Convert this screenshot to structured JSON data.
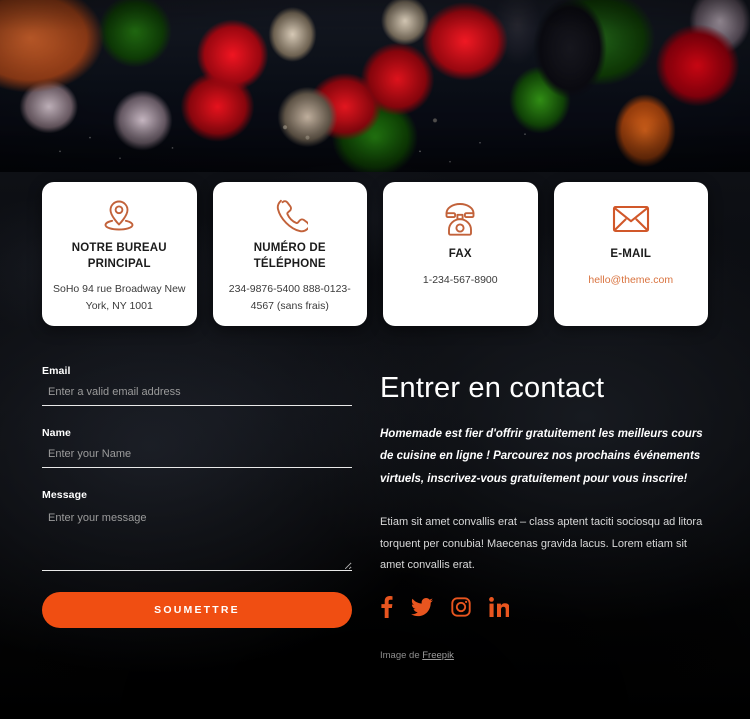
{
  "hero": {
    "alt": "fresh vegetables on dark slate background"
  },
  "cards": [
    {
      "icon": "location-pin-icon",
      "title": "NOTRE BUREAU PRINCIPAL",
      "body": "SoHo 94 rue Broadway New York, NY 1001",
      "link": null
    },
    {
      "icon": "phone-handset-icon",
      "title": "NUMÉRO DE TÉLÉPHONE",
      "body": "234-9876-5400\n888-0123-4567 (sans frais)",
      "link": null
    },
    {
      "icon": "fax-telephone-icon",
      "title": "FAX",
      "body": "1-234-567-8900",
      "link": null
    },
    {
      "icon": "envelope-icon",
      "title": "E-MAIL",
      "body": null,
      "link": "hello@theme.com"
    }
  ],
  "form": {
    "email": {
      "label": "Email",
      "placeholder": "Enter a valid email address",
      "value": ""
    },
    "name": {
      "label": "Name",
      "placeholder": "Enter your Name",
      "value": ""
    },
    "message": {
      "label": "Message",
      "placeholder": "Enter your message",
      "value": ""
    },
    "submit_label": "SOUMETTRE"
  },
  "info": {
    "title": "Entrer en contact",
    "lead": "Homemade est fier d'offrir gratuitement les meilleurs cours de cuisine en ligne ! Parcourez nos prochains événements virtuels, inscrivez-vous gratuitement pour vous inscrire!",
    "body": "Etiam sit amet convallis erat – class aptent taciti sociosqu ad litora torquent per conubia! Maecenas gravida lacus. Lorem etiam sit amet convallis erat.",
    "socials": [
      {
        "name": "facebook",
        "label": "Facebook"
      },
      {
        "name": "twitter",
        "label": "Twitter"
      },
      {
        "name": "instagram",
        "label": "Instagram"
      },
      {
        "name": "linkedin",
        "label": "LinkedIn"
      }
    ],
    "credit_prefix": "Image de ",
    "credit_link": "Freepik"
  },
  "colors": {
    "accent": "#f04e12",
    "card_icon": "#c2623a",
    "link": "#d9733f",
    "social": "#e8551f",
    "card_bg": "#ffffff",
    "page_bg": "#08090c"
  }
}
